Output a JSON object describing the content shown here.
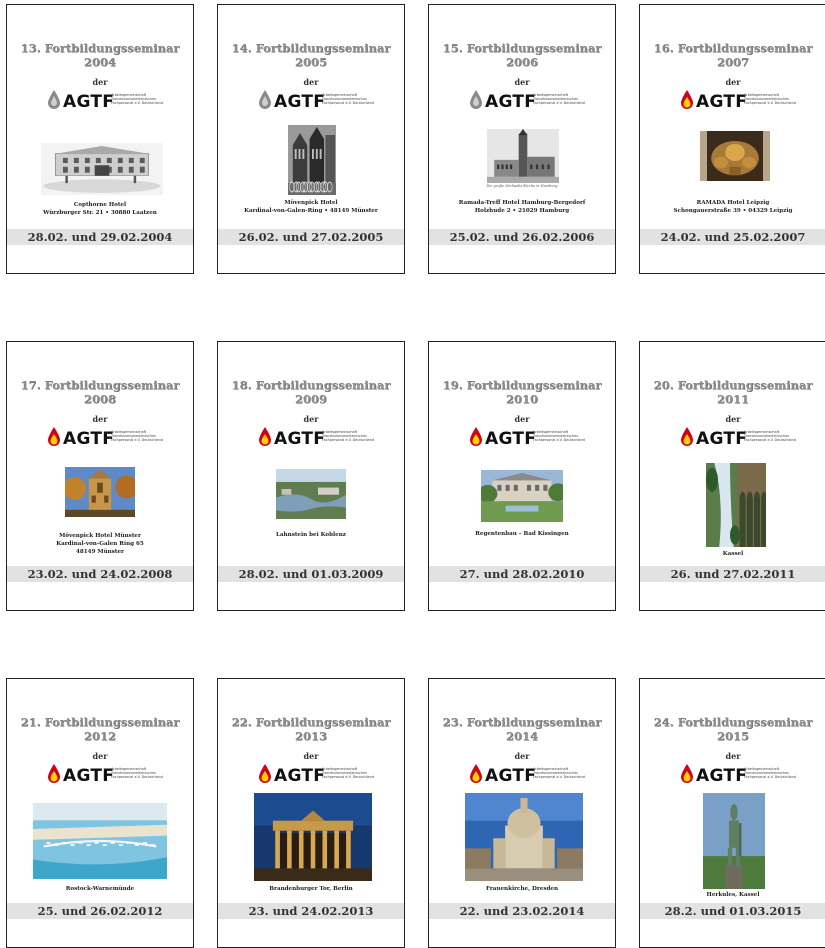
{
  "logo": {
    "text": "AGTF",
    "small_text": "Arbeitsgemeinschaft Transfusionsmedizinisches Fachpersonal e.V. Deutschland"
  },
  "colors": {
    "title_gray": "#8e8e8e",
    "date_bar": "#e2e2e2",
    "drop_gray": "#8a8a8a",
    "drop_red": "#d4001a",
    "drop_yellow": "#ffd200"
  },
  "cards": [
    {
      "title1": "13. Fortbildungsseminar",
      "year": "2004",
      "der": "der",
      "caption": [
        "Copthorne Hotel",
        "Würzburger Str. 21  •  30880 Laatzen"
      ],
      "date": "28.02. und 29.02.2004",
      "photo_caption": "",
      "icon": "gray-drop-icon",
      "photo": "hotel-building-sketch"
    },
    {
      "title1": "14. Fortbildungsseminar",
      "year": "2005",
      "der": "der",
      "caption": [
        "Mövenpick Hotel",
        "Kardinal-von-Galen-Ring • 48149 Münster"
      ],
      "date": "26.02. und 27.02.2005",
      "photo_caption": "",
      "icon": "gray-drop-icon",
      "photo": "muenster-bikes-bw"
    },
    {
      "title1": "15. Fortbildungsseminar",
      "year": "2006",
      "der": "der",
      "caption": [
        "Ramada-Treff Hotel Hamburg-Bergedorf",
        "Holzhude 2 • 21029 Hamburg"
      ],
      "date": "25.02. und 26.02.2006",
      "photo_caption": "Die große Michaelis-Kirche in Hamburg",
      "icon": "gray-drop-icon",
      "photo": "michel-church-bw"
    },
    {
      "title1": "16. Fortbildungsseminar",
      "year": "2007",
      "der": "der",
      "caption": [
        "RAMADA Hotel Leipzig",
        "Schongauerstraße 39 • 04329 Leipzig"
      ],
      "date": "24.02. und 25.02.2007",
      "photo_caption": "",
      "icon": "red-drop-icon",
      "photo": "golden-sculpture"
    },
    {
      "title1": "17. Fortbildungsseminar",
      "year": "2008",
      "der": "der",
      "caption": [
        "Mövenpick Hotel Münster",
        "Kardinal-von-Galen Ring 65",
        "48149 Münster"
      ],
      "date": "23.02. und 24.02.2008",
      "photo_caption": "",
      "icon": "red-drop-icon",
      "photo": "cathedral-autumn"
    },
    {
      "title1": "18. Fortbildungsseminar",
      "year": "2009",
      "der": "der",
      "caption": [
        "Lahnstein bei Koblenz"
      ],
      "date": "28.02. und 01.03.2009",
      "photo_caption": "",
      "icon": "red-drop-icon",
      "photo": "river-confluence"
    },
    {
      "title1": "19. Fortbildungsseminar",
      "year": "2010",
      "der": "der",
      "caption": [
        "Regentenbau – Bad Kissingen"
      ],
      "date": "27. und 28.02.2010",
      "photo_caption": "",
      "icon": "red-drop-icon",
      "photo": "park-building"
    },
    {
      "title1": "20. Fortbildungsseminar",
      "year": "2011",
      "der": "der",
      "caption": [
        "Kassel"
      ],
      "date": "26. und 27.02.2011",
      "photo_caption": "",
      "icon": "red-drop-icon",
      "photo": "waterfall-aqueduct"
    },
    {
      "title1": "21. Fortbildungsseminar",
      "year": "2012",
      "der": "der",
      "caption": [
        "Rostock-Warnemünde"
      ],
      "date": "25. und 26.02.2012",
      "photo_caption": "",
      "icon": "red-drop-icon",
      "photo": "harbor-aerial"
    },
    {
      "title1": "22. Fortbildungsseminar",
      "year": "2013",
      "der": "der",
      "caption": [
        "Brandenburger Tor, Berlin"
      ],
      "date": "23. und 24.02.2013",
      "photo_caption": "",
      "icon": "red-drop-icon",
      "photo": "brandenburg-gate-night"
    },
    {
      "title1": "23. Fortbildungsseminar",
      "year": "2014",
      "der": "der",
      "caption": [
        "Frauenkirche, Dresden"
      ],
      "date": "22. und 23.02.2014",
      "photo_caption": "",
      "icon": "red-drop-icon",
      "photo": "frauenkirche"
    },
    {
      "title1": "24. Fortbildungsseminar",
      "year": "2015",
      "der": "der",
      "caption": [
        "Herkules, Kassel"
      ],
      "date": "28.2. und 01.03.2015",
      "photo_caption": "",
      "icon": "red-drop-icon",
      "photo": "hercules-statue"
    }
  ]
}
